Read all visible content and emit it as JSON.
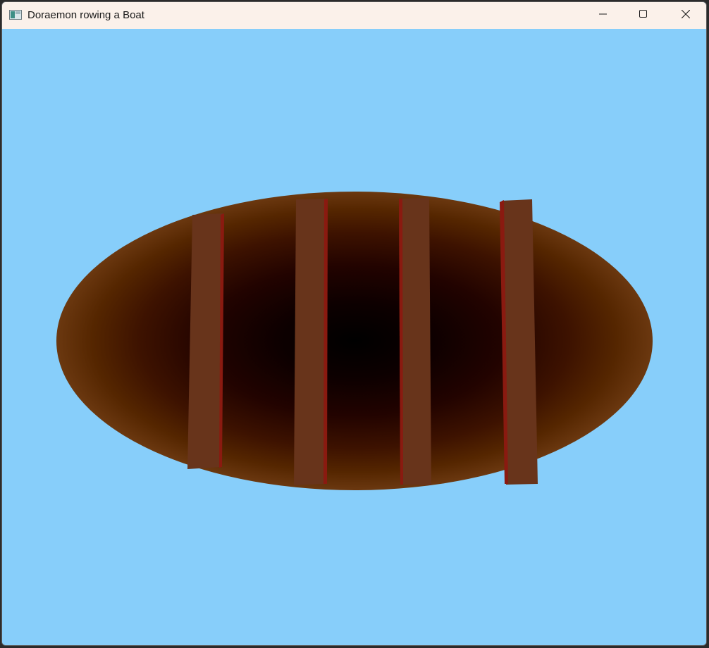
{
  "window": {
    "title": "Doraemon rowing a Boat",
    "icon": "app-window-icon",
    "controls": {
      "minimize_icon": "minimize-icon",
      "maximize_icon": "maximize-icon",
      "close_icon": "close-icon"
    }
  },
  "scene": {
    "sky_color": "#87cefa",
    "boat": {
      "hull_outer_color": "#6b3810",
      "hull_inner_color": "#000000",
      "plank_color": "#68341b",
      "plank_edge_color": "#8a1a10",
      "plank_count": 4
    }
  }
}
